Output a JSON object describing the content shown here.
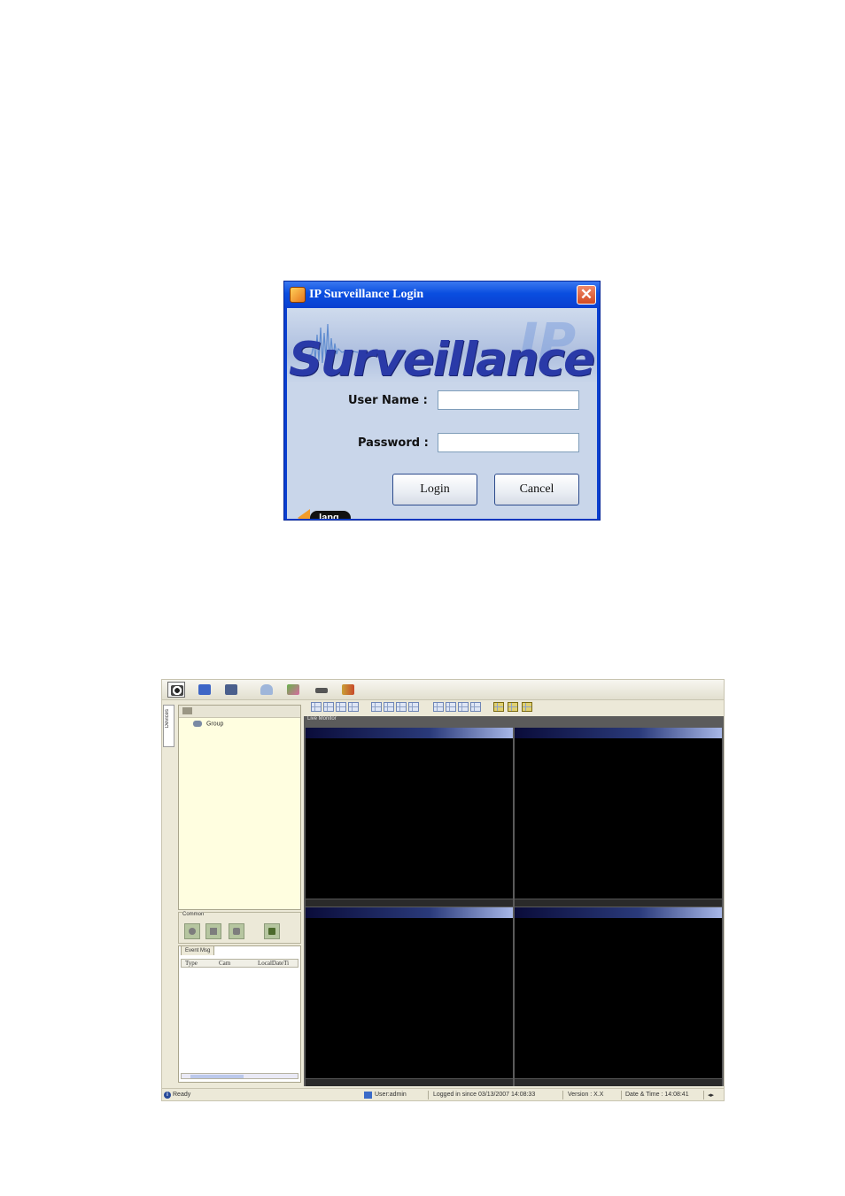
{
  "login_dialog": {
    "title": "IP Surveillance Login",
    "brand_text": "Surveillance",
    "brand_overlay": "IP",
    "user_name_label": "User Name :",
    "user_name_value": "",
    "password_label": "Password :",
    "password_value": "",
    "lang_label": "lang.",
    "login_button": "Login",
    "cancel_button": "Cancel",
    "close_glyph": "✕"
  },
  "main_window": {
    "toolbar_icons": [
      "eye-icon",
      "camera-setup-icon",
      "film-icon",
      "lock-icon",
      "chart-icon",
      "phone-icon",
      "exit-icon"
    ],
    "side_tab": "Devices",
    "tree": {
      "root": "Group"
    },
    "common": {
      "label": "Common",
      "buttons": [
        "record-icon",
        "audio-icon",
        "snapshot-icon",
        "trash-icon"
      ]
    },
    "event_panel": {
      "tab": "Event Msg",
      "columns": [
        "Type",
        "Cam",
        "LocalDateTi"
      ]
    },
    "live_monitor_label": "Live Monitor",
    "cameras": 4,
    "status_bar": {
      "ready": "Ready",
      "user": "User:admin",
      "logged_in": "Logged in since 03/13/2007 14:08:33",
      "version": "Version : X.X",
      "date_time": "Date & Time : 14:08:41"
    }
  }
}
